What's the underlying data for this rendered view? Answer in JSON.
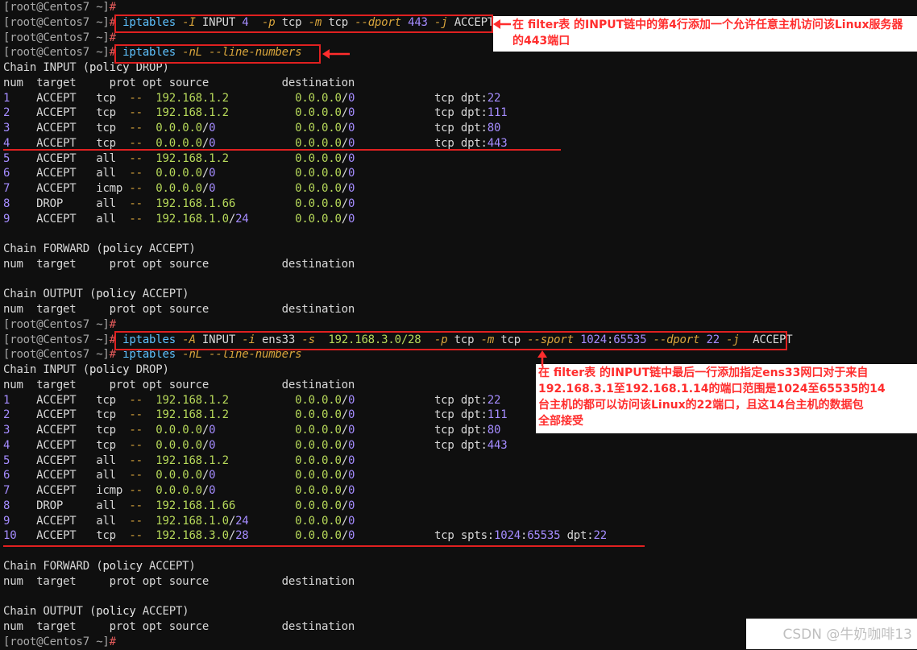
{
  "prompt": {
    "user": "root",
    "host": "Centos7",
    "cwd": "~"
  },
  "commands": {
    "insert": {
      "bin": "iptables",
      "a": "-I",
      "chain": "INPUT",
      "pos": "4",
      "p": "-p",
      "proto": "tcp",
      "m": "-m",
      "mod": "tcp",
      "dport": "--dport",
      "port": "443",
      "j": "-j",
      "target": "ACCEPT"
    },
    "list": {
      "bin": "iptables",
      "args": "-nL --line-numbers"
    },
    "append": {
      "bin": "iptables",
      "a": "-A",
      "chain": "INPUT",
      "i": "-i",
      "iface": "ens33",
      "s": "-s",
      "src": "192.168.3.0/28",
      "p": "-p",
      "proto": "tcp",
      "m": "-m",
      "mod": "tcp",
      "sport": "--sport",
      "srange": "1024:65535",
      "dport": "--dport",
      "port": "22",
      "j": "-j",
      "target": "ACCEPT"
    }
  },
  "tables": {
    "header": [
      "num",
      "target",
      "prot opt source",
      "destination"
    ],
    "chain_input": "Chain INPUT (policy DROP)",
    "chain_forward": "Chain FORWARD (policy ACCEPT)",
    "chain_output": "Chain OUTPUT (policy ACCEPT)",
    "rows1": [
      {
        "n": "1",
        "t": "ACCEPT",
        "p": "tcp",
        "src": "192.168.1.2",
        "dst": "0.0.0.0/0",
        "extra": "tcp dpt:22"
      },
      {
        "n": "2",
        "t": "ACCEPT",
        "p": "tcp",
        "src": "192.168.1.2",
        "dst": "0.0.0.0/0",
        "extra": "tcp dpt:111"
      },
      {
        "n": "3",
        "t": "ACCEPT",
        "p": "tcp",
        "src": "0.0.0.0/0",
        "dst": "0.0.0.0/0",
        "extra": "tcp dpt:80"
      },
      {
        "n": "4",
        "t": "ACCEPT",
        "p": "tcp",
        "src": "0.0.0.0/0",
        "dst": "0.0.0.0/0",
        "extra": "tcp dpt:443"
      },
      {
        "n": "5",
        "t": "ACCEPT",
        "p": "all",
        "src": "192.168.1.2",
        "dst": "0.0.0.0/0",
        "extra": ""
      },
      {
        "n": "6",
        "t": "ACCEPT",
        "p": "all",
        "src": "0.0.0.0/0",
        "dst": "0.0.0.0/0",
        "extra": ""
      },
      {
        "n": "7",
        "t": "ACCEPT",
        "p": "icmp",
        "src": "0.0.0.0/0",
        "dst": "0.0.0.0/0",
        "extra": ""
      },
      {
        "n": "8",
        "t": "DROP",
        "p": "all",
        "src": "192.168.1.66",
        "dst": "0.0.0.0/0",
        "extra": ""
      },
      {
        "n": "9",
        "t": "ACCEPT",
        "p": "all",
        "src": "192.168.1.0/24",
        "dst": "0.0.0.0/0",
        "extra": ""
      }
    ],
    "rows2_extra": {
      "n": "10",
      "t": "ACCEPT",
      "p": "tcp",
      "src": "192.168.3.0/28",
      "dst": "0.0.0.0/0",
      "extra": "tcp spts:1024:65535 dpt:22"
    }
  },
  "annotations": {
    "note1": "在 filter表 的INPUT链中的第4行添加一个允许任意主机访问该Linux服务器\n的443端口",
    "note2": "在 filter表 的INPUT链中最后一行添加指定ens33网口对于来自\n192.168.3.1至192.168.1.14的端口范围是1024至65535的14\n台主机的都可以访问该Linux的22端口，且这14台主机的数据包\n全部接受"
  },
  "watermark": "CSDN @牛奶咖啡13",
  "colors": {
    "accent_red": "#e02020",
    "cmd_blue": "#5ec2ff",
    "opt_orange": "#d9a53c",
    "num_purple": "#a58cff",
    "ip_green": "#b7d95a"
  }
}
